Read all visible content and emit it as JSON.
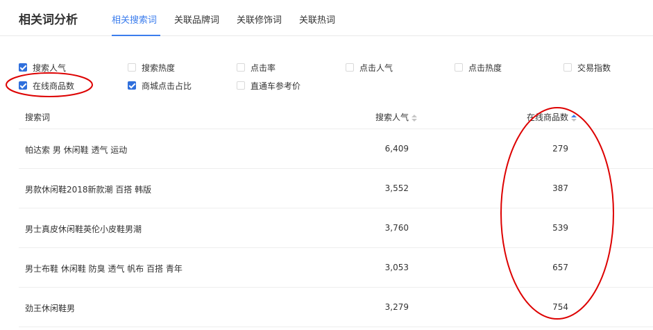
{
  "header": {
    "title": "相关词分析",
    "tabs": [
      {
        "label": "相关搜索词",
        "active": true
      },
      {
        "label": "关联品牌词",
        "active": false
      },
      {
        "label": "关联修饰词",
        "active": false
      },
      {
        "label": "关联热词",
        "active": false
      }
    ]
  },
  "filters": [
    {
      "label": "搜索人气",
      "checked": true
    },
    {
      "label": "搜索热度",
      "checked": false
    },
    {
      "label": "点击率",
      "checked": false
    },
    {
      "label": "点击人气",
      "checked": false
    },
    {
      "label": "点击热度",
      "checked": false
    },
    {
      "label": "交易指数",
      "checked": false
    },
    {
      "label": "在线商品数",
      "checked": true
    },
    {
      "label": "商城点击占比",
      "checked": true
    },
    {
      "label": "直通车参考价",
      "checked": false
    }
  ],
  "table": {
    "columns": [
      "搜索词",
      "搜索人气",
      "在线商品数"
    ],
    "rows": [
      {
        "keyword": "帕达索 男 休闲鞋 透气 运动",
        "popularity": "6,409",
        "online_count": "279"
      },
      {
        "keyword": "男款休闲鞋2018新款潮 百搭 韩版",
        "popularity": "3,552",
        "online_count": "387"
      },
      {
        "keyword": "男士真皮休闲鞋英伦小皮鞋男潮",
        "popularity": "3,760",
        "online_count": "539"
      },
      {
        "keyword": "男士布鞋 休闲鞋 防臭 透气 帆布 百搭 青年",
        "popularity": "3,053",
        "online_count": "657"
      },
      {
        "keyword": "劲王休闲鞋男",
        "popularity": "3,279",
        "online_count": "754"
      }
    ]
  },
  "colors": {
    "accent": "#3b7ded",
    "checkbox_checked": "#2f6fdc",
    "annotation": "#dd0000"
  }
}
